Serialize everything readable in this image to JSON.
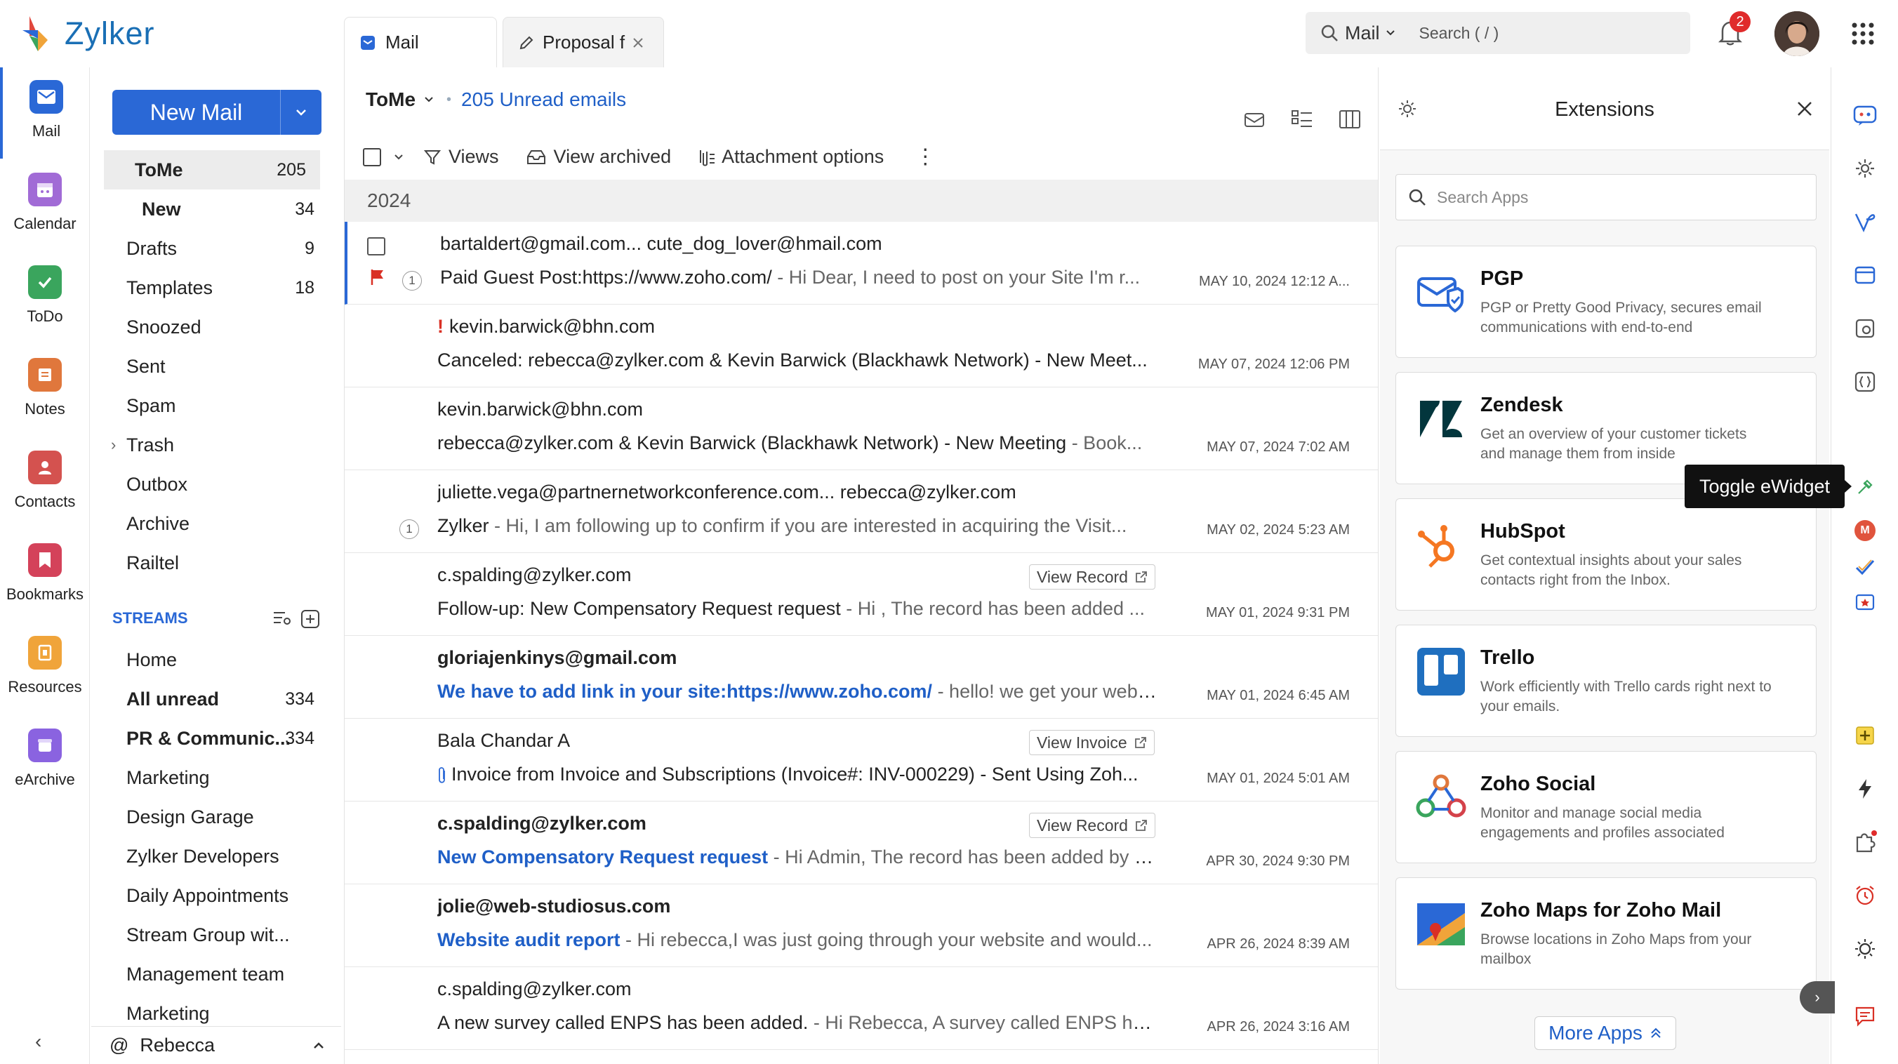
{
  "app": {
    "name": "Zylker"
  },
  "colors": {
    "accent": "#2a68d6",
    "link": "#1f5fc7",
    "badge": "#e02b2b",
    "flag": "#d93025"
  },
  "rail": [
    {
      "label": "Mail",
      "icon": "mail-icon",
      "color": "#2a68d6"
    },
    {
      "label": "Calendar",
      "icon": "calendar-icon",
      "color": "#a16bd6"
    },
    {
      "label": "ToDo",
      "icon": "todo-icon",
      "color": "#3aa55d"
    },
    {
      "label": "Notes",
      "icon": "notes-icon",
      "color": "#e0773c"
    },
    {
      "label": "Contacts",
      "icon": "contacts-icon",
      "color": "#d4524f"
    },
    {
      "label": "Bookmarks",
      "icon": "bookmark-icon",
      "color": "#d4425a"
    },
    {
      "label": "Resources",
      "icon": "resources-icon",
      "color": "#f0a43a"
    },
    {
      "label": "eArchive",
      "icon": "earchive-icon",
      "color": "#8a63e0"
    }
  ],
  "compose": {
    "label": "New Mail"
  },
  "folders": [
    {
      "name": "ToMe",
      "count": "205"
    },
    {
      "name": "New",
      "count": "34"
    },
    {
      "name": "Drafts",
      "count": "9"
    },
    {
      "name": "Templates",
      "count": "18"
    },
    {
      "name": "Snoozed",
      "count": ""
    },
    {
      "name": "Sent",
      "count": ""
    },
    {
      "name": "Spam",
      "count": ""
    },
    {
      "name": "Trash",
      "count": ""
    },
    {
      "name": "Outbox",
      "count": ""
    },
    {
      "name": "Archive",
      "count": ""
    },
    {
      "name": "Railtel",
      "count": ""
    }
  ],
  "streams": {
    "title": "STREAMS",
    "items": [
      {
        "name": "Home",
        "count": ""
      },
      {
        "name": "All unread",
        "count": "334"
      },
      {
        "name": "PR & Communic...",
        "count": "334"
      },
      {
        "name": "Marketing",
        "count": ""
      },
      {
        "name": "Design Garage",
        "count": ""
      },
      {
        "name": "Zylker Developers",
        "count": ""
      },
      {
        "name": "Daily Appointments",
        "count": ""
      },
      {
        "name": "Stream Group wit...",
        "count": ""
      },
      {
        "name": "Management team",
        "count": ""
      },
      {
        "name": "Marketing",
        "count": ""
      }
    ]
  },
  "user": {
    "name": "Rebecca",
    "prefix": "@"
  },
  "tabs": [
    {
      "label": "Mail"
    },
    {
      "label": "Proposal f"
    }
  ],
  "search": {
    "scope": "Mail",
    "placeholder": "Search ( / )"
  },
  "notifications": {
    "count": "2"
  },
  "list": {
    "folder": "ToMe",
    "unread": "205 Unread emails",
    "year": "2024",
    "toolbar": {
      "views": "Views",
      "archived": "View archived",
      "attach": "Attachment options"
    }
  },
  "emails": [
    {
      "from": "bartaldert@gmail.com... cute_dog_lover@hmail.com",
      "subject": "Paid Guest Post:https://www.zoho.com/",
      "preview": " - Hi Dear, I need to post on your Site I'm r...",
      "date": "MAY 10, 2024 12:12 A...",
      "thread": "1"
    },
    {
      "from": "kevin.barwick@bhn.com",
      "subject": "Canceled: rebecca@zylker.com & Kevin Barwick (Blackhawk Network) - New Meet...",
      "preview": "",
      "date": "MAY 07, 2024 12:06 PM",
      "important": "!"
    },
    {
      "from": "kevin.barwick@bhn.com",
      "subject": "rebecca@zylker.com & Kevin Barwick (Blackhawk Network) - New Meeting",
      "preview": " - Book...",
      "date": "MAY 07, 2024 7:02 AM"
    },
    {
      "from": "juliette.vega@partnernetworkconference.com... rebecca@zylker.com",
      "subject": "Zylker",
      "preview": " - Hi, I am following up to confirm if you are interested in acquiring the Visit...",
      "date": "MAY 02, 2024 5:23 AM",
      "thread": "1"
    },
    {
      "from": "c.spalding@zylker.com",
      "subject": "Follow-up: New Compensatory Request request",
      "preview": " - Hi , The record has been added ...",
      "date": "MAY 01, 2024 9:31 PM",
      "button": "View Record"
    },
    {
      "from": "gloriajenkinys@gmail.com",
      "subject": "We have to add link in your site:https://www.zoho.com/",
      "preview": " - hello! we get your webs...",
      "date": "MAY 01, 2024 6:45 AM",
      "unread": true
    },
    {
      "from": "Bala Chandar A",
      "subject": "Invoice from Invoice and Subscriptions (Invoice#: INV-000229) - Sent Using Zoh...",
      "preview": "",
      "date": "MAY 01, 2024 5:01 AM",
      "button": "View Invoice",
      "attachment": true
    },
    {
      "from": "c.spalding@zylker.com",
      "subject": "New Compensatory Request request",
      "preview": " - Hi Admin, The record has been added by C...",
      "date": "APR 30, 2024 9:30 PM",
      "button": "View Record",
      "unread": true
    },
    {
      "from": "jolie@web-studiosus.com",
      "subject": "Website audit report",
      "preview": " - Hi rebecca,I was just going through your website and would...",
      "date": "APR 26, 2024 8:39 AM",
      "unread": true
    },
    {
      "from": "c.spalding@zylker.com",
      "subject": "A new survey called ENPS has been added.",
      "preview": " - Hi Rebecca, A survey called ENPS has...",
      "date": "APR 26, 2024 3:16 AM"
    }
  ],
  "extensions": {
    "title": "Extensions",
    "search_placeholder": "Search Apps",
    "more": "More Apps",
    "apps": [
      {
        "name": "PGP",
        "desc": "PGP or Pretty Good Privacy, secures email communications with end-to-end"
      },
      {
        "name": "Zendesk",
        "desc": "Get an overview of your customer tickets and manage them from inside"
      },
      {
        "name": "HubSpot",
        "desc": "Get contextual insights about your sales contacts right from the Inbox."
      },
      {
        "name": "Trello",
        "desc": "Work efficiently with Trello cards right next to your emails."
      },
      {
        "name": "Zoho Social",
        "desc": "Monitor and manage social media engagements and profiles associated"
      },
      {
        "name": "Zoho Maps for Zoho Mail",
        "desc": "Browse locations in Zoho Maps from your mailbox"
      }
    ]
  },
  "tooltip": "Toggle eWidget",
  "right_rail_badge": "M"
}
